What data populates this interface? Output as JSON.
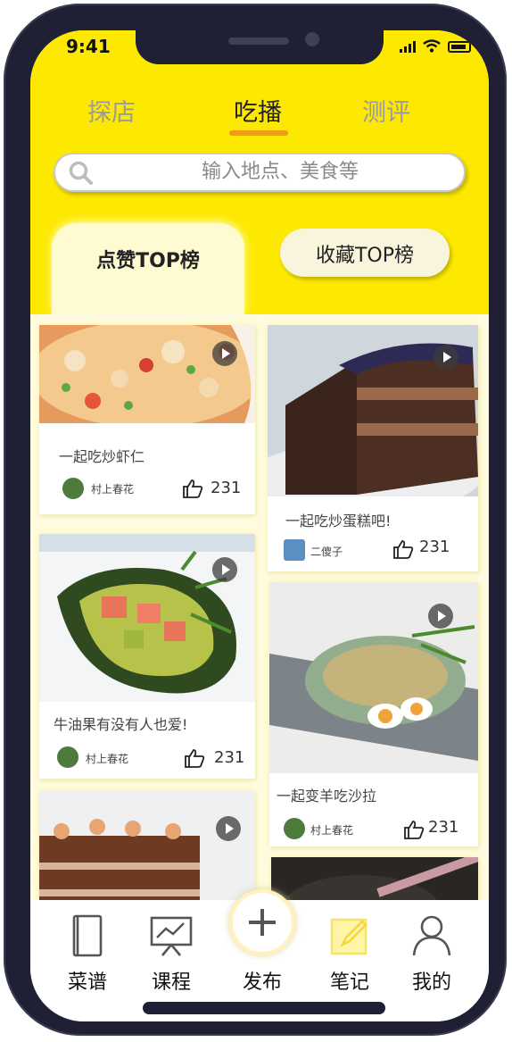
{
  "status_bar": {
    "time": "9:41"
  },
  "top_tabs": [
    {
      "label": "探店",
      "active": false
    },
    {
      "label": "吃播",
      "active": true
    },
    {
      "label": "测评",
      "active": false
    }
  ],
  "search": {
    "placeholder": "输入地点、美食等"
  },
  "ranking": {
    "active_tab": "点赞TOP榜",
    "other_tab": "收藏TOP榜"
  },
  "feed": {
    "left": [
      {
        "title": "一起吃炒虾仁",
        "user": "村上春花",
        "likes": "231",
        "image": "shrimp-pasta-photo"
      },
      {
        "title": "牛油果有没有人也爱!",
        "user": "村上春花",
        "likes": "231",
        "image": "avocado-salad-photo"
      },
      {
        "title": "",
        "user": "",
        "likes": "",
        "image": "chocolate-cake-photo"
      }
    ],
    "right": [
      {
        "title": "一起吃炒蛋糕吧!",
        "user": "二傻子",
        "likes": "231",
        "image": "blueberry-cake-photo"
      },
      {
        "title": "一起变羊吃沙拉",
        "user": "村上春花",
        "likes": "231",
        "image": "egg-salad-photo"
      },
      {
        "title": "",
        "user": "",
        "likes": "",
        "image": "pan-dish-photo"
      }
    ]
  },
  "bottom_nav": [
    {
      "label": "菜谱",
      "icon": "book-icon"
    },
    {
      "label": "课程",
      "icon": "presentation-icon"
    },
    {
      "label": "发布",
      "icon": "plus-icon"
    },
    {
      "label": "笔记",
      "icon": "note-edit-icon"
    },
    {
      "label": "我的",
      "icon": "user-icon"
    }
  ],
  "colors": {
    "header": "#fde900",
    "accent": "#f39a19",
    "feed_bg": "#fffbe0"
  }
}
